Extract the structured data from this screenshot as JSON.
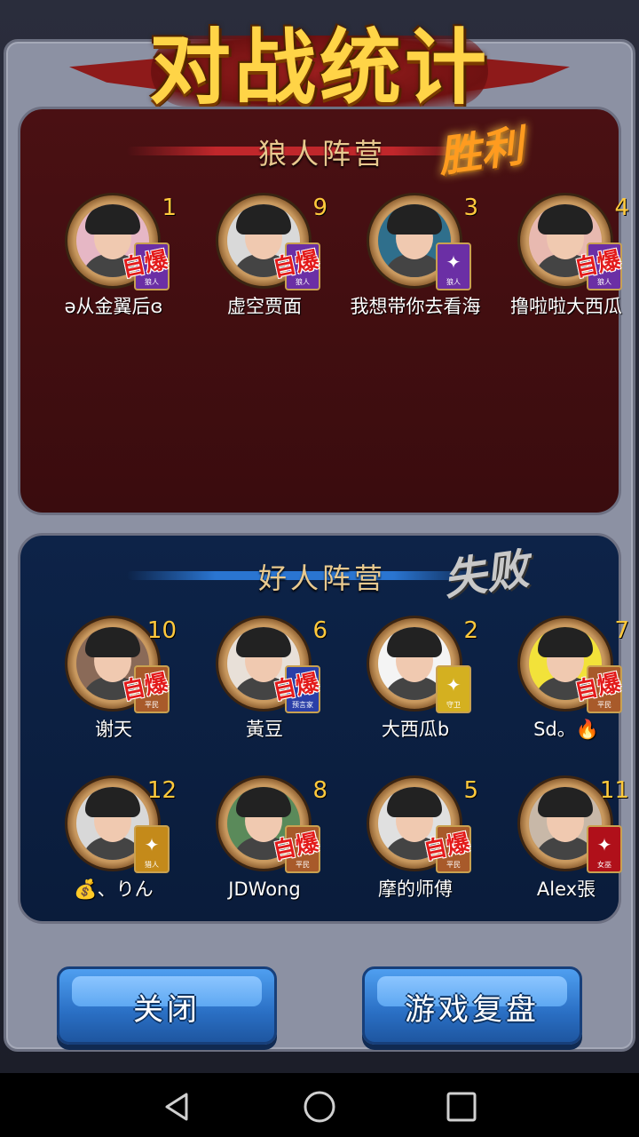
{
  "title": "对战统计",
  "wolf_camp": {
    "name": "狼人阵营",
    "result": "胜利",
    "players": [
      {
        "seat": "1",
        "name": "ə从金翼后ɞ",
        "role": "狼人",
        "exploded": true,
        "stamp": "自爆",
        "role_color": "#6b2fa5",
        "avatar_bg": "#e6b7c5"
      },
      {
        "seat": "9",
        "name": "虚空贾面",
        "role": "狼人",
        "exploded": true,
        "stamp": "自爆",
        "role_color": "#6b2fa5",
        "avatar_bg": "#d9d9d9"
      },
      {
        "seat": "3",
        "name": "我想带你去看海",
        "role": "狼人",
        "exploded": false,
        "stamp": "",
        "role_color": "#6b2fa5",
        "avatar_bg": "#2f6f8c"
      },
      {
        "seat": "4",
        "name": "撸啦啦大西瓜",
        "role": "狼人",
        "exploded": true,
        "stamp": "自爆",
        "role_color": "#6b2fa5",
        "avatar_bg": "#e8b9b0"
      }
    ]
  },
  "good_camp": {
    "name": "好人阵营",
    "result": "失败",
    "players": [
      {
        "seat": "10",
        "name": "谢天",
        "role": "平民",
        "exploded": true,
        "stamp": "自爆",
        "role_color": "#a85a2a",
        "avatar_bg": "#8a6a58"
      },
      {
        "seat": "6",
        "name": "黃豆",
        "role": "预言家",
        "exploded": true,
        "stamp": "自爆",
        "role_color": "#2a3fa8",
        "avatar_bg": "#e8e0d8"
      },
      {
        "seat": "2",
        "name": "大西瓜b",
        "role": "守卫",
        "exploded": false,
        "stamp": "",
        "role_color": "#d4b020",
        "avatar_bg": "#f4f4f4"
      },
      {
        "seat": "7",
        "name": "Sd。🔥",
        "role": "平民",
        "exploded": true,
        "stamp": "自爆",
        "role_color": "#a85a2a",
        "avatar_bg": "#f2e23a"
      },
      {
        "seat": "12",
        "name": "💰、りん",
        "role": "猎人",
        "exploded": false,
        "stamp": "",
        "role_color": "#c48a1a",
        "avatar_bg": "#d8d8d8"
      },
      {
        "seat": "8",
        "name": "JDWong",
        "role": "平民",
        "exploded": true,
        "stamp": "自爆",
        "role_color": "#a85a2a",
        "avatar_bg": "#5a8a5a"
      },
      {
        "seat": "5",
        "name": "摩的师傅",
        "role": "平民",
        "exploded": true,
        "stamp": "自爆",
        "role_color": "#a85a2a",
        "avatar_bg": "#e0e0e0"
      },
      {
        "seat": "11",
        "name": "Alex張",
        "role": "女巫",
        "exploded": false,
        "stamp": "",
        "role_color": "#b0101a",
        "avatar_bg": "#c8b8a8"
      }
    ]
  },
  "buttons": {
    "close": "关闭",
    "replay": "游戏复盘"
  }
}
